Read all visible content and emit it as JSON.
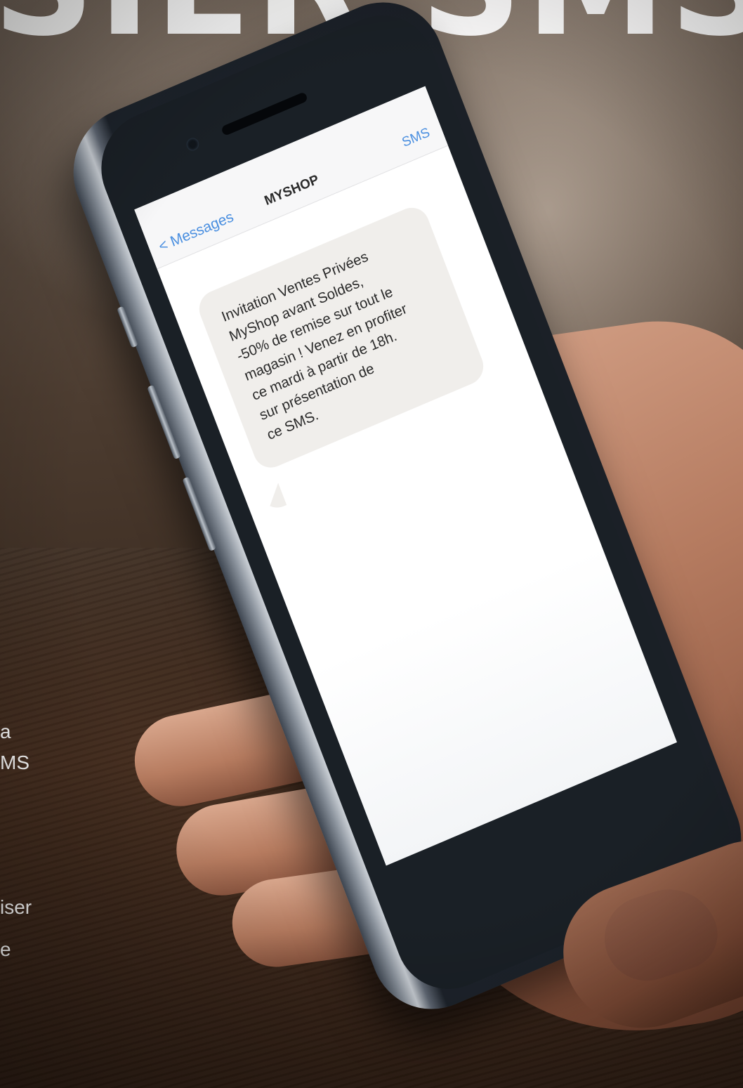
{
  "headline": "SIER SMS",
  "side_text": [
    "a",
    "MS",
    "iser",
    "e"
  ],
  "phone": {
    "nav": {
      "back_label": "< Messages",
      "title": "MYSHOP",
      "right_label": "SMS"
    },
    "message_lines": [
      "Invitation Ventes Privées",
      "MyShop avant  Soldes,",
      "-50% de remise sur tout le",
      "magasin ! Venez en profiter",
      "ce mardi à partir de 18h.",
      "sur présentation de",
      "ce SMS."
    ]
  },
  "colors": {
    "ios_blue": "#4a8fe0",
    "bubble": "#f0eeeb",
    "headline": "#ffffff"
  }
}
